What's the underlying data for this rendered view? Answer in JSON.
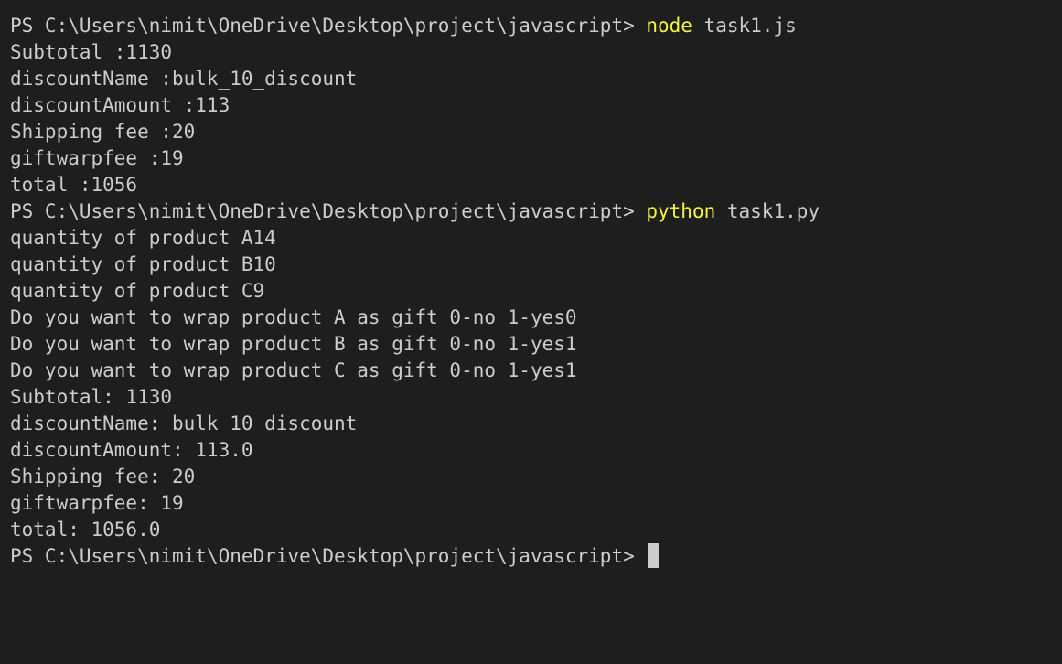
{
  "terminal": {
    "background": "#1e1e1e",
    "foreground": "#cccccc",
    "command_color": "#f5f543",
    "prompt": "PS C:\\Users\\nimit\\OneDrive\\Desktop\\project\\javascript> ",
    "command1": {
      "program": "node",
      "args": " task1.js"
    },
    "output1": [
      "Subtotal :1130",
      "discountName :bulk_10_discount",
      "discountAmount :113",
      "Shipping fee :20",
      "giftwarpfee :19",
      "total :1056"
    ],
    "command2": {
      "program": "python",
      "args": " task1.py"
    },
    "output2": [
      "quantity of product A14",
      "quantity of product B10",
      "quantity of product C9",
      "Do you want to wrap product A as gift 0-no 1-yes0",
      "Do you want to wrap product B as gift 0-no 1-yes1",
      "Do you want to wrap product C as gift 0-no 1-yes1",
      "Subtotal: 1130",
      "discountName: bulk_10_discount",
      "discountAmount: 113.0",
      "Shipping fee: 20",
      "giftwarpfee: 19",
      "total: 1056.0"
    ]
  }
}
